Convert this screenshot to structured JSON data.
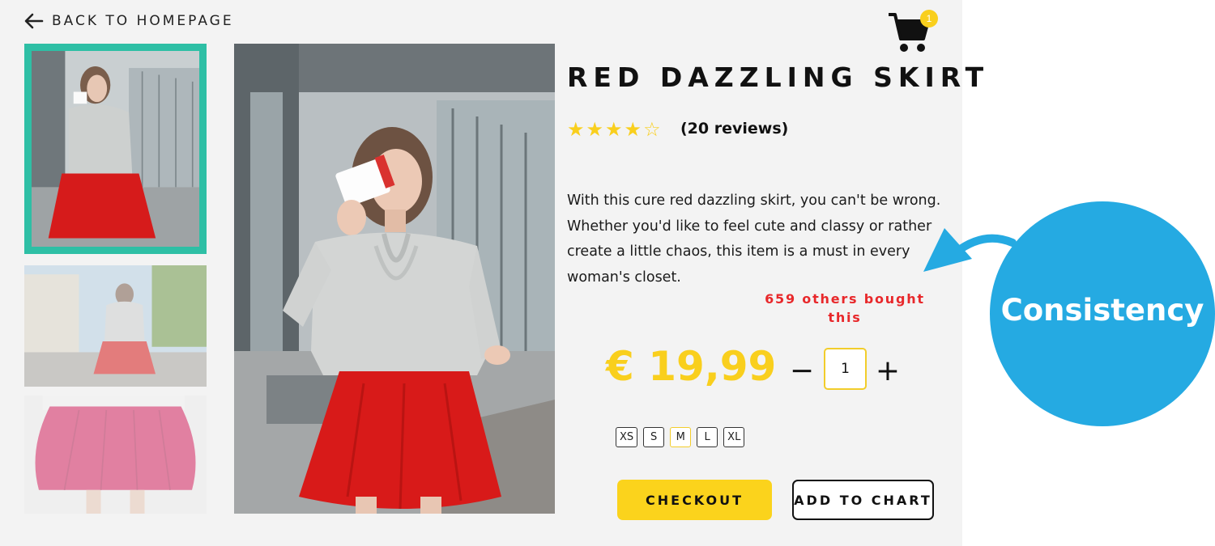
{
  "nav": {
    "back_label": "BACK TO HOMEPAGE"
  },
  "cart": {
    "count": "1"
  },
  "gallery": {
    "thumbnails": [
      "woman in red skirt drinking coffee",
      "woman in red skirt on street",
      "pink skirt close-up"
    ],
    "selected_index": 0
  },
  "product": {
    "title": "RED DAZZLING SKIRT",
    "rating": 4,
    "rating_max": 5,
    "reviews": "(20 reviews)",
    "description": "With this cure red dazzling skirt, you can't be wrong. Whether you'd like to feel cute and classy or rather create a little chaos, this item is a must in every woman's closet.",
    "social_proof": "659 others bought this",
    "price": "€ 19,99",
    "quantity": "1",
    "sizes": [
      "XS",
      "S",
      "M",
      "L",
      "XL"
    ],
    "selected_size": "M"
  },
  "actions": {
    "checkout": "CHECKOUT",
    "add_to_cart": "ADD TO CHART"
  },
  "annotation": {
    "label": "Consistency"
  },
  "icons": {
    "back": "arrow-left-icon",
    "cart": "shopping-cart-icon",
    "star_full": "star-filled-icon",
    "star_empty": "star-outline-icon",
    "minus": "minus-icon",
    "plus": "plus-icon"
  },
  "colors": {
    "accent_yellow": "#f9cf1d",
    "thumb_border": "#2ebfa5",
    "social_proof_red": "#e8282b",
    "annotation_blue": "#25aae2",
    "panel_bg": "#f3f3f3"
  }
}
